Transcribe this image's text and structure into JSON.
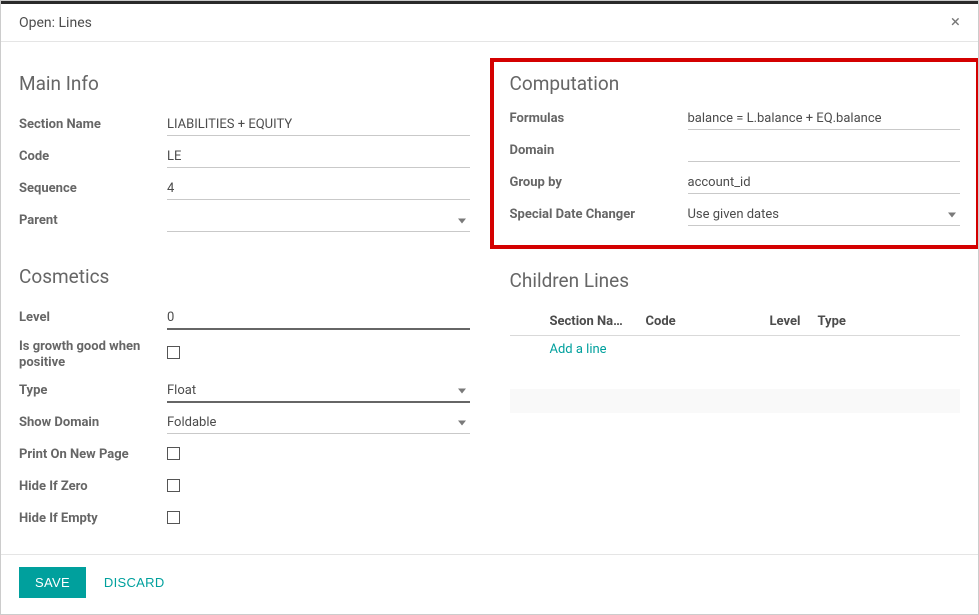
{
  "header": {
    "title": "Open: Lines"
  },
  "main_info": {
    "heading": "Main Info",
    "section_name_label": "Section Name",
    "section_name_value": "LIABILITIES + EQUITY",
    "code_label": "Code",
    "code_value": "LE",
    "sequence_label": "Sequence",
    "sequence_value": "4",
    "parent_label": "Parent",
    "parent_value": ""
  },
  "cosmetics": {
    "heading": "Cosmetics",
    "level_label": "Level",
    "level_value": "0",
    "growth_label": "Is growth good when positive",
    "growth_checked": false,
    "type_label": "Type",
    "type_value": "Float",
    "show_domain_label": "Show Domain",
    "show_domain_value": "Foldable",
    "print_new_page_label": "Print On New Page",
    "print_new_page_checked": false,
    "hide_if_zero_label": "Hide If Zero",
    "hide_if_zero_checked": false,
    "hide_if_empty_label": "Hide If Empty",
    "hide_if_empty_checked": false
  },
  "computation": {
    "heading": "Computation",
    "formulas_label": "Formulas",
    "formulas_value": "balance = L.balance + EQ.balance",
    "domain_label": "Domain",
    "domain_value": "",
    "groupby_label": "Group by",
    "groupby_value": "account_id",
    "date_changer_label": "Special Date Changer",
    "date_changer_value": "Use given dates"
  },
  "children": {
    "heading": "Children Lines",
    "cols": {
      "name": "Section Na…",
      "code": "Code",
      "level": "Level",
      "type": "Type"
    },
    "add_line": "Add a line"
  },
  "footer": {
    "save": "SAVE",
    "discard": "DISCARD"
  }
}
